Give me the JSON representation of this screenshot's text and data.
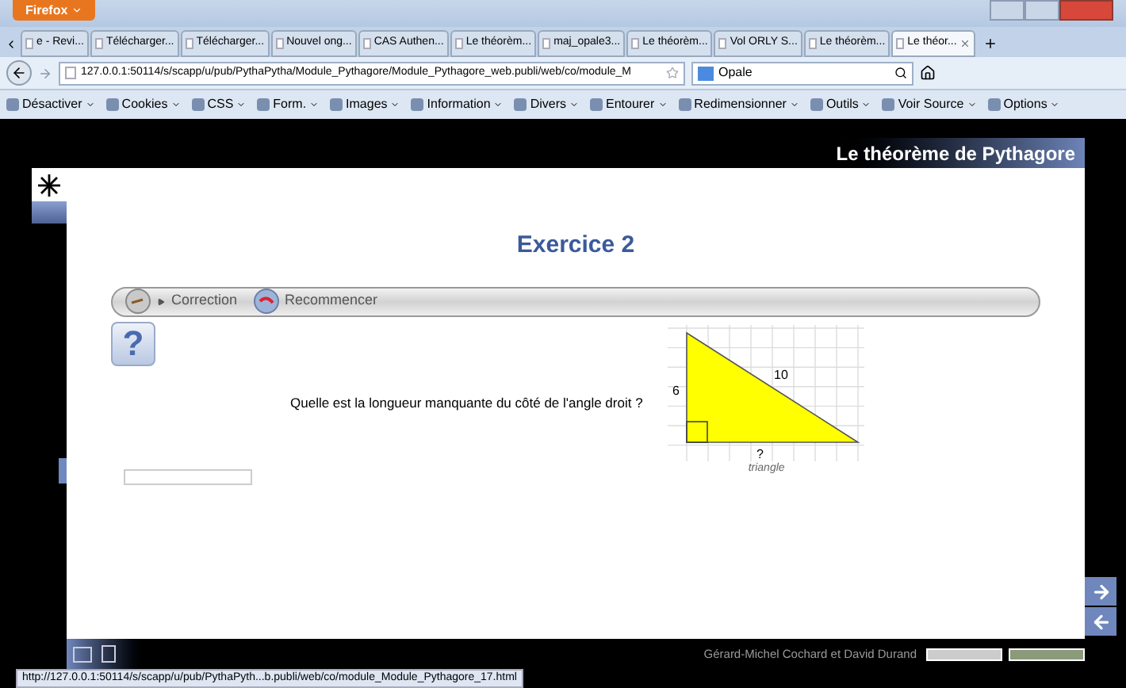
{
  "browser": {
    "menu_button": "Firefox",
    "tabs": [
      {
        "label": "e - Revi...",
        "selected": false
      },
      {
        "label": "Télécharger...",
        "selected": false
      },
      {
        "label": "Télécharger...",
        "selected": false
      },
      {
        "label": "Nouvel ong...",
        "selected": false
      },
      {
        "label": "CAS Authen...",
        "selected": false
      },
      {
        "label": "Le théorèm...",
        "selected": false
      },
      {
        "label": "maj_opale3...",
        "selected": false
      },
      {
        "label": "Le théorèm...",
        "selected": false
      },
      {
        "label": "Vol ORLY S...",
        "selected": false
      },
      {
        "label": "Le théorèm...",
        "selected": false
      },
      {
        "label": "Le théor...",
        "selected": true
      }
    ],
    "url": "127.0.0.1:50114/s/scapp/u/pub/PythaPytha/Module_Pythagore/Module_Pythagore_web.publi/web/co/module_M",
    "search": "Opale",
    "toolbar": [
      "Désactiver",
      "Cookies",
      "CSS",
      "Form.",
      "Images",
      "Information",
      "Divers",
      "Entourer",
      "Redimensionner",
      "Outils",
      "Voir Source",
      "Options"
    ],
    "status_url": "http://127.0.0.1:50114/s/scapp/u/pub/PythaPyth...b.publi/web/co/module_Module_Pythagore_17.html"
  },
  "page": {
    "header_title": "Le théorème de Pythagore",
    "exercise_title": "Exercice 2",
    "help_icon": "?",
    "actions": [
      {
        "kind": "correction",
        "label": "Correction"
      },
      {
        "kind": "restart",
        "label": "Recommencer"
      }
    ],
    "question": "Quelle est la longueur manquante du côté de l'angle droit ?",
    "figure": {
      "side_vertical": "6",
      "hypotenuse": "10",
      "side_horizontal": "?",
      "caption": "triangle"
    },
    "credits": "Gérard-Michel Cochard et David Durand"
  }
}
